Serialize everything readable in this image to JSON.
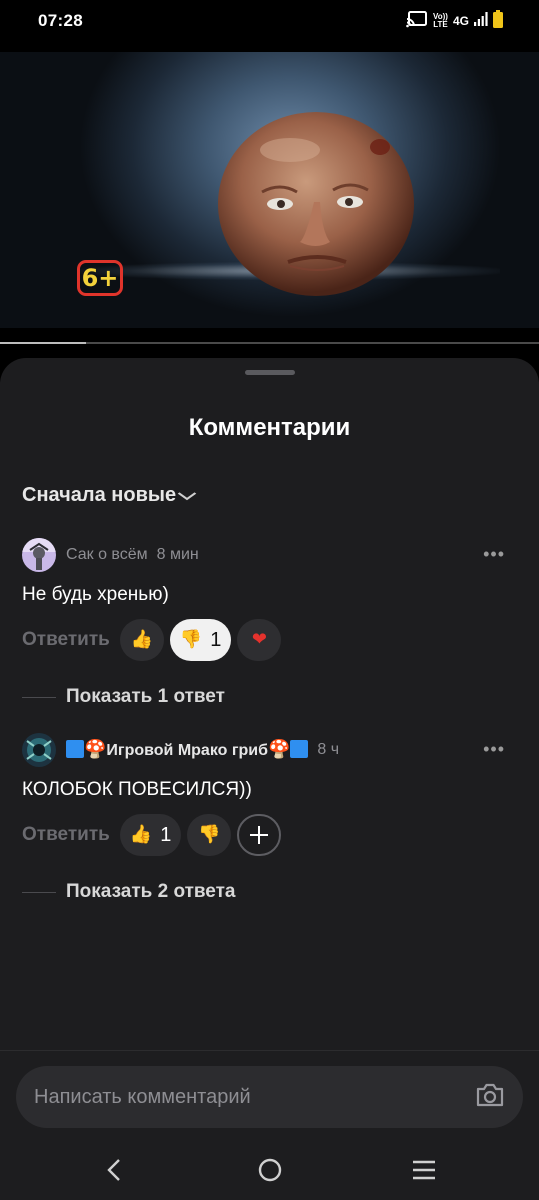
{
  "status_bar": {
    "time": "07:28",
    "network": "4G",
    "volte_top": "Vo))",
    "volte_bottom": "LTE",
    "icons": [
      "cast-icon",
      "volte-icon",
      "signal-icon",
      "battery-icon"
    ]
  },
  "video": {
    "age_rating": "6+",
    "progress_fraction": 0.16
  },
  "sheet": {
    "title": "Комментарии",
    "sort_label": "Сначала новые"
  },
  "comments": [
    {
      "author": "Сак о всём",
      "time": "8 мин",
      "text": "Не будь хренью)",
      "reply_label": "Ответить",
      "reactions": [
        {
          "icon": "thumbs-up-icon",
          "count": ""
        },
        {
          "icon": "thumbs-down-icon",
          "count": "1",
          "selected": true
        },
        {
          "icon": "heart-icon",
          "count": ""
        }
      ],
      "show_replies": "Показать 1 ответ"
    },
    {
      "author": "Игровой Мрако гриб",
      "time": "8 ч",
      "text": "КОЛОБОК ПОВЕСИЛСЯ))",
      "reply_label": "Ответить",
      "reactions": [
        {
          "icon": "thumbs-up-icon",
          "count": "1"
        },
        {
          "icon": "thumbs-down-icon",
          "count": ""
        },
        {
          "icon": "add-reaction-icon",
          "count": ""
        }
      ],
      "show_replies": "Показать 2 ответа"
    }
  ],
  "composer": {
    "placeholder": "Написать комментарий",
    "camera_icon": "camera-icon"
  },
  "nav": {
    "icons": [
      "back-icon",
      "home-icon",
      "menu-icon"
    ]
  },
  "colors": {
    "sheet_bg": "#1d1d1f",
    "reaction_bg": "#2e2e31",
    "selected_reaction_bg": "#f1f1f1",
    "muted_text": "#8e8e93",
    "age_badge_border": "#e0342b",
    "age_badge_text": "#f3d23b"
  }
}
